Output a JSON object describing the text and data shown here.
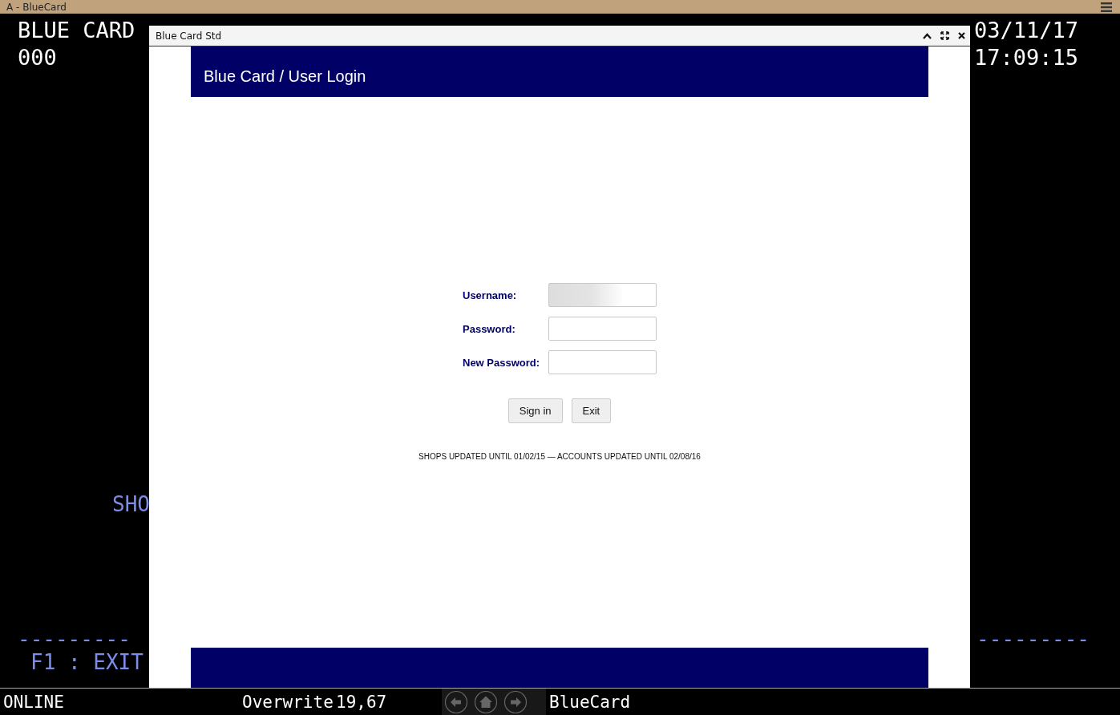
{
  "app_title": "A - BlueCard",
  "terminal": {
    "title": "BLUE CARD",
    "code": "000",
    "date": "03/11/17",
    "time": "17:09:15",
    "partial_label": "SHO",
    "divider_left": "---------",
    "divider_right": "---------",
    "function_key": "F1 : EXIT"
  },
  "dialog": {
    "title": "Blue Card Std",
    "header": "Blue Card / User Login",
    "fields": [
      {
        "label": "Username:",
        "redacted": true
      },
      {
        "label": "Password:",
        "redacted": false
      },
      {
        "label": "New Password:",
        "redacted": false
      }
    ],
    "buttons": [
      "Sign in",
      "Exit"
    ],
    "footer": "SHOPS UPDATED UNTIL 01/02/15 — ACCOUNTS UPDATED UNTIL 02/08/16"
  },
  "status_bar": {
    "mode": "ONLINE",
    "insert_mode": "Overwrite",
    "cursor": "19,67",
    "session": "BlueCard"
  }
}
